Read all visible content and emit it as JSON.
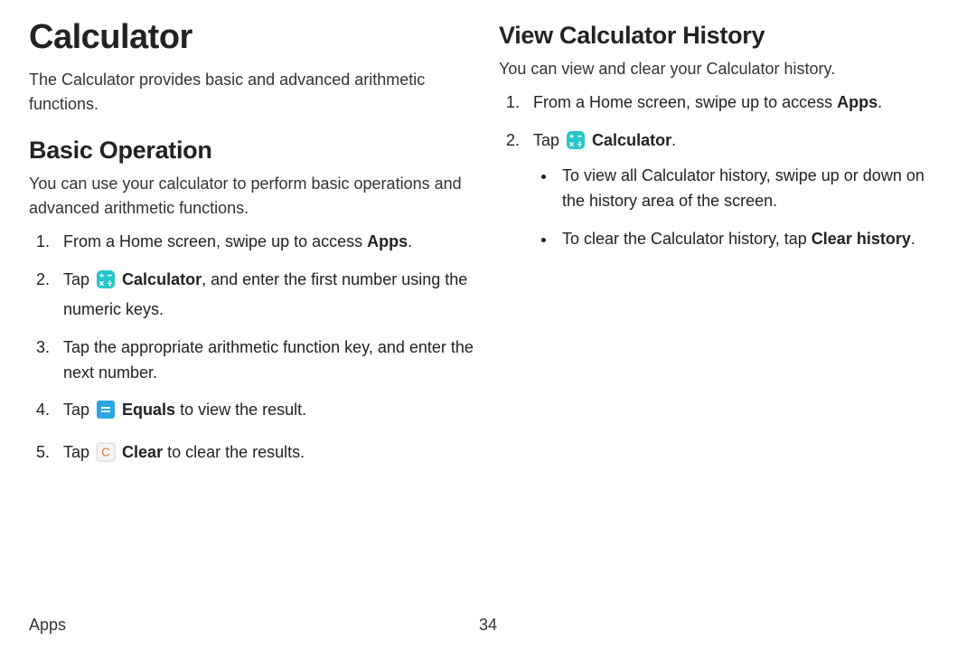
{
  "title": "Calculator",
  "intro": "The Calculator provides basic and advanced arithmetic functions.",
  "basic": {
    "heading": "Basic Operation",
    "lead": "You can use your calculator to perform basic operations and advanced arithmetic functions.",
    "steps": {
      "s1": {
        "pre": "From a Home screen, swipe up to access ",
        "apps": "Apps",
        "post": "."
      },
      "s2": {
        "pre": "Tap ",
        "calc_label": "Calculator",
        "post": ", and enter the first number using the numeric keys."
      },
      "s3": "Tap the appropriate arithmetic function key, and enter the next number.",
      "s4": {
        "pre": "Tap ",
        "equals_label": "Equals",
        "post": " to view the result."
      },
      "s5": {
        "pre": "Tap ",
        "clear_label": "Clear",
        "post": " to clear the results."
      }
    }
  },
  "history": {
    "heading": "View Calculator History",
    "lead": "You can view and clear your Calculator history.",
    "steps": {
      "s1": {
        "pre": "From a Home screen, swipe up to access ",
        "apps": "Apps",
        "post": "."
      },
      "s2": {
        "pre": "Tap ",
        "calc_label": "Calculator",
        "post": "."
      }
    },
    "bullets": {
      "b1": "To view all Calculator history, swipe up or down on the history area of the screen.",
      "b2": {
        "pre": "To clear the Calculator history, tap ",
        "clear_hist": "Clear history",
        "post": "."
      }
    }
  },
  "footer": {
    "section": "Apps",
    "page": "34"
  },
  "icons": {
    "calculator": "calculator-icon",
    "equals": "equals-icon",
    "clear": "clear-c-icon"
  },
  "colors": {
    "teal": "#27c4c9",
    "blue": "#2aa7e0",
    "orange": "#e76f2a",
    "text": "#222222",
    "white": "#ffffff",
    "keybg": "#f4f4f4",
    "keyborder": "#d6d6d6"
  }
}
